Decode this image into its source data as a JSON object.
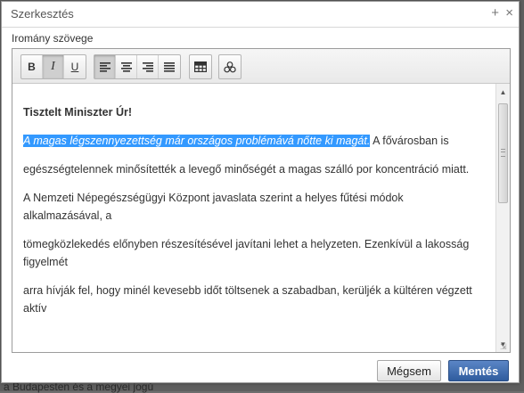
{
  "dialog": {
    "title": "Szerkesztés",
    "plus_glyph": "+",
    "close_glyph": "×",
    "field_label": "Iromány szövege",
    "cancel_label": "Mégsem",
    "save_label": "Mentés"
  },
  "toolbar": {
    "bold": "B",
    "italic": "I",
    "underline": "U",
    "align_left_icon": "align-left-icon",
    "align_center_icon": "align-center-icon",
    "align_right_icon": "align-right-icon",
    "justify_icon": "justify-icon",
    "table_icon": "table-icon",
    "special_icon": "clover-icon"
  },
  "content": {
    "heading": "Tisztelt Miniszter Úr!",
    "p1_selected": "A magas légszennyezettség már országos problémává nőtte ki magát.",
    "p1_rest": " A fővárosban is",
    "p2": "egészségtelennek minősítették a levegő minőségét a magas szálló por koncentráció miatt.",
    "p3": "A Nemzeti Népegészségügyi Központ javaslata szerint a helyes fűtési módok alkalmazásával, a",
    "p4": "tömegközlekedés előnyben részesítésével javítani lehet a helyzeten. Ezenkívül a lakosság figyelmét",
    "p5": "arra hívják fel, hogy minél kevesebb időt töltsenek a szabadban, kerüljék a kültéren végzett aktív"
  },
  "background": {
    "behind_text": "a Budapesten és a megyei jogú"
  }
}
